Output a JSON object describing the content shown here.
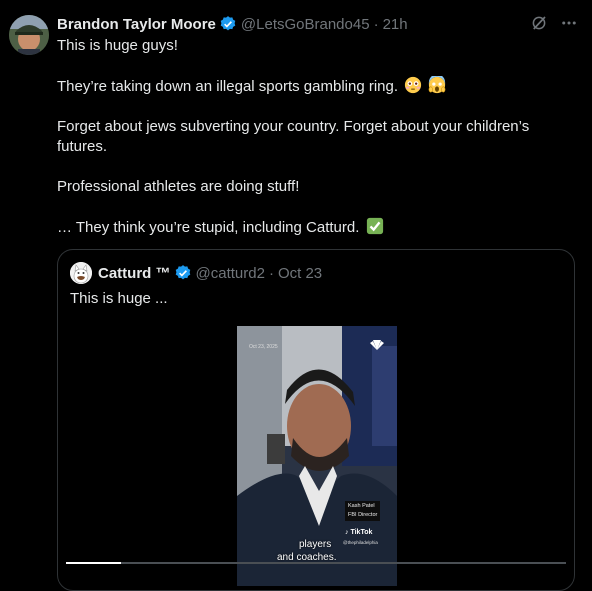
{
  "tweet": {
    "author_name": "Brandon Taylor Moore",
    "handle": "@LetsGoBrando45",
    "time": "21h",
    "separator": "·",
    "lines": [
      "This is huge guys!",
      "",
      "They’re taking down an illegal sports gambling ring.",
      "",
      "Forget about jews subverting your country.  Forget about your children’s futures.",
      "",
      "Professional athletes are doing stuff!",
      "",
      "… They think you’re stupid, including Catturd."
    ]
  },
  "quote": {
    "author_name": "Catturd ™",
    "handle": "@catturd2",
    "date": "Oct 23",
    "separator": "·",
    "text": "This is huge ...",
    "video": {
      "date_overlay": "Oct 23, 2025",
      "nameplate_name": "Kash Patel",
      "nameplate_title": "FBI Director",
      "tiktok_label": "TikTok",
      "tiktok_handle": "@thephiladelphia",
      "subtitle_line1": "players",
      "subtitle_line2": "and coaches.",
      "progress_fraction": 0.11
    }
  },
  "icons": [
    "verified-badge-icon",
    "grok-icon",
    "more-icon",
    "flushed-face-emoji",
    "scream-emoji",
    "check-mark-emoji",
    "nbc-peacock-icon"
  ],
  "colors": {
    "background": "#000000",
    "text": "#e7e9ea",
    "muted": "#71767b",
    "verified": "#1d9bf0",
    "border": "#2f3336"
  }
}
